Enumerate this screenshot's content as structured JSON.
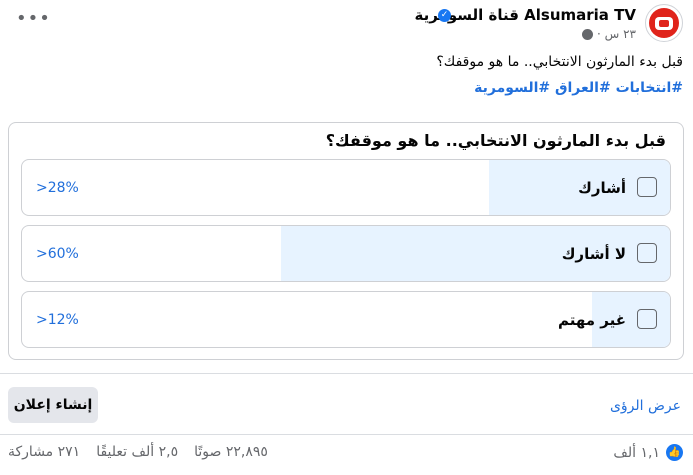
{
  "post": {
    "page_name": "Alsumaria TV قناة السومرية",
    "time": "٢٣ س ·",
    "text": "قبل بدء المارثون الانتخابي.. ما هو موقفك؟",
    "hashtags": "#انتخابات #العراق #السومرية"
  },
  "poll": {
    "question": "قبل بدء المارثون الانتخابي.. ما هو موقفك؟",
    "options": [
      {
        "label": "أشارك",
        "percent_text": ">28%",
        "percent": 28
      },
      {
        "label": "لا أشارك",
        "percent_text": ">60%",
        "percent": 60
      },
      {
        "label": "غير مهتم",
        "percent_text": ">12%",
        "percent": 12
      }
    ]
  },
  "actions": {
    "create_ad": "إنشاء إعلان",
    "view_insights": "عرض الرؤى"
  },
  "stats": {
    "reactions": "١,١ ألف",
    "votes": "٢٢,٨٩٥ صوتًا",
    "comments": "٢,٥ ألف تعليقًا",
    "shares": "٢٧١ مشاركة"
  },
  "icons": {
    "more": "more-icon",
    "verified": "verified-icon",
    "globe": "globe-icon",
    "like": "like-icon"
  },
  "colors": {
    "accent": "#216fdb",
    "brand": "#e0241b",
    "poll_fill": "#e7f3ff"
  }
}
